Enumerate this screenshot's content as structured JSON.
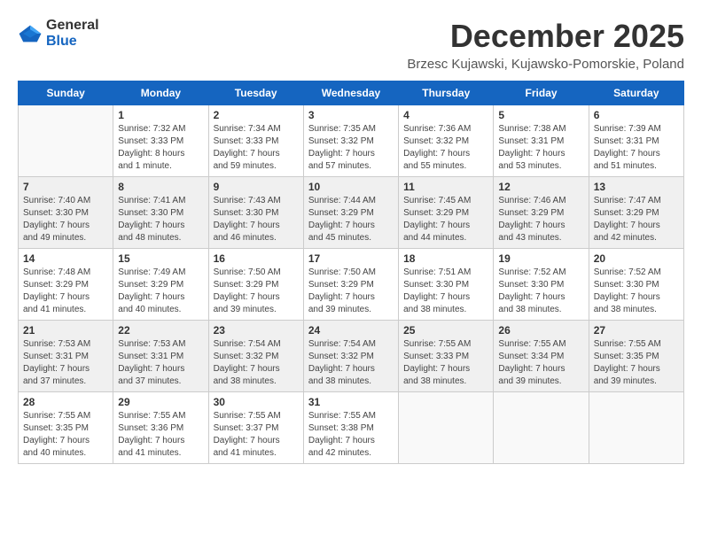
{
  "header": {
    "logo_general": "General",
    "logo_blue": "Blue",
    "month": "December 2025",
    "location": "Brzesc Kujawski, Kujawsko-Pomorskie, Poland"
  },
  "weekdays": [
    "Sunday",
    "Monday",
    "Tuesday",
    "Wednesday",
    "Thursday",
    "Friday",
    "Saturday"
  ],
  "weeks": [
    [
      {
        "day": "",
        "empty": true
      },
      {
        "day": "1",
        "sunrise": "Sunrise: 7:32 AM",
        "sunset": "Sunset: 3:33 PM",
        "daylight": "Daylight: 8 hours and 1 minute."
      },
      {
        "day": "2",
        "sunrise": "Sunrise: 7:34 AM",
        "sunset": "Sunset: 3:33 PM",
        "daylight": "Daylight: 7 hours and 59 minutes."
      },
      {
        "day": "3",
        "sunrise": "Sunrise: 7:35 AM",
        "sunset": "Sunset: 3:32 PM",
        "daylight": "Daylight: 7 hours and 57 minutes."
      },
      {
        "day": "4",
        "sunrise": "Sunrise: 7:36 AM",
        "sunset": "Sunset: 3:32 PM",
        "daylight": "Daylight: 7 hours and 55 minutes."
      },
      {
        "day": "5",
        "sunrise": "Sunrise: 7:38 AM",
        "sunset": "Sunset: 3:31 PM",
        "daylight": "Daylight: 7 hours and 53 minutes."
      },
      {
        "day": "6",
        "sunrise": "Sunrise: 7:39 AM",
        "sunset": "Sunset: 3:31 PM",
        "daylight": "Daylight: 7 hours and 51 minutes."
      }
    ],
    [
      {
        "day": "7",
        "sunrise": "Sunrise: 7:40 AM",
        "sunset": "Sunset: 3:30 PM",
        "daylight": "Daylight: 7 hours and 49 minutes."
      },
      {
        "day": "8",
        "sunrise": "Sunrise: 7:41 AM",
        "sunset": "Sunset: 3:30 PM",
        "daylight": "Daylight: 7 hours and 48 minutes."
      },
      {
        "day": "9",
        "sunrise": "Sunrise: 7:43 AM",
        "sunset": "Sunset: 3:30 PM",
        "daylight": "Daylight: 7 hours and 46 minutes."
      },
      {
        "day": "10",
        "sunrise": "Sunrise: 7:44 AM",
        "sunset": "Sunset: 3:29 PM",
        "daylight": "Daylight: 7 hours and 45 minutes."
      },
      {
        "day": "11",
        "sunrise": "Sunrise: 7:45 AM",
        "sunset": "Sunset: 3:29 PM",
        "daylight": "Daylight: 7 hours and 44 minutes."
      },
      {
        "day": "12",
        "sunrise": "Sunrise: 7:46 AM",
        "sunset": "Sunset: 3:29 PM",
        "daylight": "Daylight: 7 hours and 43 minutes."
      },
      {
        "day": "13",
        "sunrise": "Sunrise: 7:47 AM",
        "sunset": "Sunset: 3:29 PM",
        "daylight": "Daylight: 7 hours and 42 minutes."
      }
    ],
    [
      {
        "day": "14",
        "sunrise": "Sunrise: 7:48 AM",
        "sunset": "Sunset: 3:29 PM",
        "daylight": "Daylight: 7 hours and 41 minutes."
      },
      {
        "day": "15",
        "sunrise": "Sunrise: 7:49 AM",
        "sunset": "Sunset: 3:29 PM",
        "daylight": "Daylight: 7 hours and 40 minutes."
      },
      {
        "day": "16",
        "sunrise": "Sunrise: 7:50 AM",
        "sunset": "Sunset: 3:29 PM",
        "daylight": "Daylight: 7 hours and 39 minutes."
      },
      {
        "day": "17",
        "sunrise": "Sunrise: 7:50 AM",
        "sunset": "Sunset: 3:29 PM",
        "daylight": "Daylight: 7 hours and 39 minutes."
      },
      {
        "day": "18",
        "sunrise": "Sunrise: 7:51 AM",
        "sunset": "Sunset: 3:30 PM",
        "daylight": "Daylight: 7 hours and 38 minutes."
      },
      {
        "day": "19",
        "sunrise": "Sunrise: 7:52 AM",
        "sunset": "Sunset: 3:30 PM",
        "daylight": "Daylight: 7 hours and 38 minutes."
      },
      {
        "day": "20",
        "sunrise": "Sunrise: 7:52 AM",
        "sunset": "Sunset: 3:30 PM",
        "daylight": "Daylight: 7 hours and 38 minutes."
      }
    ],
    [
      {
        "day": "21",
        "sunrise": "Sunrise: 7:53 AM",
        "sunset": "Sunset: 3:31 PM",
        "daylight": "Daylight: 7 hours and 37 minutes."
      },
      {
        "day": "22",
        "sunrise": "Sunrise: 7:53 AM",
        "sunset": "Sunset: 3:31 PM",
        "daylight": "Daylight: 7 hours and 37 minutes."
      },
      {
        "day": "23",
        "sunrise": "Sunrise: 7:54 AM",
        "sunset": "Sunset: 3:32 PM",
        "daylight": "Daylight: 7 hours and 38 minutes."
      },
      {
        "day": "24",
        "sunrise": "Sunrise: 7:54 AM",
        "sunset": "Sunset: 3:32 PM",
        "daylight": "Daylight: 7 hours and 38 minutes."
      },
      {
        "day": "25",
        "sunrise": "Sunrise: 7:55 AM",
        "sunset": "Sunset: 3:33 PM",
        "daylight": "Daylight: 7 hours and 38 minutes."
      },
      {
        "day": "26",
        "sunrise": "Sunrise: 7:55 AM",
        "sunset": "Sunset: 3:34 PM",
        "daylight": "Daylight: 7 hours and 39 minutes."
      },
      {
        "day": "27",
        "sunrise": "Sunrise: 7:55 AM",
        "sunset": "Sunset: 3:35 PM",
        "daylight": "Daylight: 7 hours and 39 minutes."
      }
    ],
    [
      {
        "day": "28",
        "sunrise": "Sunrise: 7:55 AM",
        "sunset": "Sunset: 3:35 PM",
        "daylight": "Daylight: 7 hours and 40 minutes."
      },
      {
        "day": "29",
        "sunrise": "Sunrise: 7:55 AM",
        "sunset": "Sunset: 3:36 PM",
        "daylight": "Daylight: 7 hours and 41 minutes."
      },
      {
        "day": "30",
        "sunrise": "Sunrise: 7:55 AM",
        "sunset": "Sunset: 3:37 PM",
        "daylight": "Daylight: 7 hours and 41 minutes."
      },
      {
        "day": "31",
        "sunrise": "Sunrise: 7:55 AM",
        "sunset": "Sunset: 3:38 PM",
        "daylight": "Daylight: 7 hours and 42 minutes."
      },
      {
        "day": "",
        "empty": true
      },
      {
        "day": "",
        "empty": true
      },
      {
        "day": "",
        "empty": true
      }
    ]
  ]
}
